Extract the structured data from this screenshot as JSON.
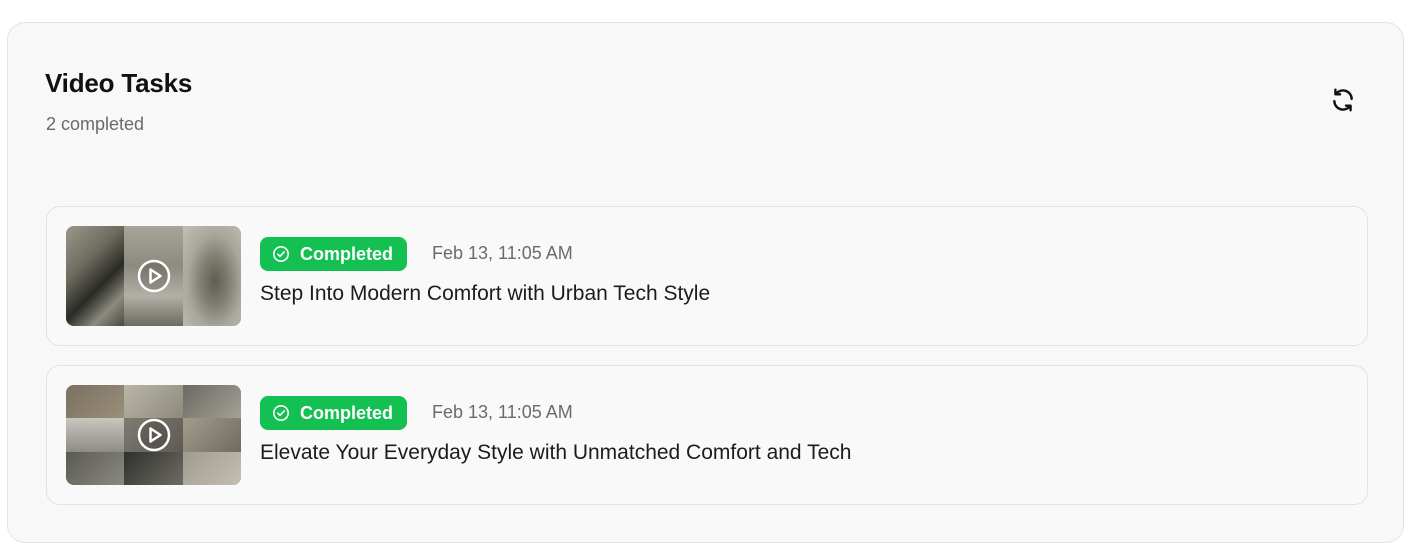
{
  "header": {
    "title": "Video Tasks",
    "subtitle": "2 completed"
  },
  "icons": {
    "refresh": "refresh-icon",
    "play": "play-circle-icon",
    "status": "check-circle-icon"
  },
  "colors": {
    "status_completed": "#14c052"
  },
  "tasks": [
    {
      "status": "Completed",
      "timestamp": "Feb 13, 11:05 AM",
      "title": "Step Into Modern Comfort with Urban Tech Style"
    },
    {
      "status": "Completed",
      "timestamp": "Feb 13, 11:05 AM",
      "title": "Elevate Your Everyday Style with Unmatched Comfort and Tech"
    }
  ]
}
